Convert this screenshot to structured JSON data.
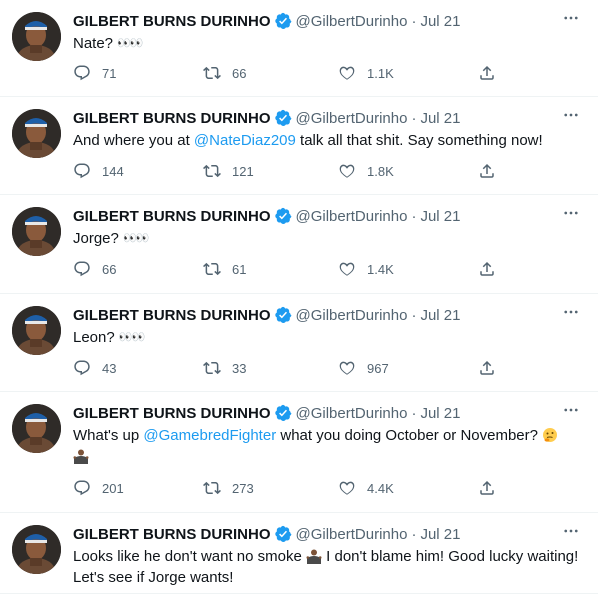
{
  "tweets": [
    {
      "name": "GILBERT BURNS DURINHO",
      "handle": "@GilbertDurinho",
      "dot": "·",
      "time": "Jul 21",
      "segments": [
        {
          "t": "text",
          "v": "Nate? "
        },
        {
          "t": "eyes",
          "v": "👀👀"
        }
      ],
      "stats": {
        "replies": "71",
        "retweets": "66",
        "likes": "1.1K"
      }
    },
    {
      "name": "GILBERT BURNS DURINHO",
      "handle": "@GilbertDurinho",
      "dot": "·",
      "time": "Jul 21",
      "segments": [
        {
          "t": "text",
          "v": "And where you at "
        },
        {
          "t": "mention",
          "v": "@NateDiaz209"
        },
        {
          "t": "text",
          "v": " talk all that shit. Say something now!"
        }
      ],
      "stats": {
        "replies": "144",
        "retweets": "121",
        "likes": "1.8K"
      }
    },
    {
      "name": "GILBERT BURNS DURINHO",
      "handle": "@GilbertDurinho",
      "dot": "·",
      "time": "Jul 21",
      "segments": [
        {
          "t": "text",
          "v": "Jorge? "
        },
        {
          "t": "eyes",
          "v": "👀👀"
        }
      ],
      "stats": {
        "replies": "66",
        "retweets": "61",
        "likes": "1.4K"
      }
    },
    {
      "name": "GILBERT BURNS DURINHO",
      "handle": "@GilbertDurinho",
      "dot": "·",
      "time": "Jul 21",
      "segments": [
        {
          "t": "text",
          "v": "Leon? "
        },
        {
          "t": "eyes",
          "v": "👀👀"
        }
      ],
      "stats": {
        "replies": "43",
        "retweets": "33",
        "likes": "967"
      }
    },
    {
      "name": "GILBERT BURNS DURINHO",
      "handle": "@GilbertDurinho",
      "dot": "·",
      "time": "Jul 21",
      "segments": [
        {
          "t": "text",
          "v": "What's up "
        },
        {
          "t": "mention",
          "v": "@GamebredFighter"
        },
        {
          "t": "text",
          "v": " what you doing October or November? "
        },
        {
          "t": "emoji",
          "v": "thinking-face-emoji"
        },
        {
          "t": "br",
          "v": ""
        },
        {
          "t": "emoji",
          "v": "person-shrugging-emoji"
        }
      ],
      "stats": {
        "replies": "201",
        "retweets": "273",
        "likes": "4.4K"
      }
    },
    {
      "name": "GILBERT BURNS DURINHO",
      "handle": "@GilbertDurinho",
      "dot": "·",
      "time": "Jul 21",
      "segments": [
        {
          "t": "text",
          "v": "Looks like he don't want no smoke "
        },
        {
          "t": "emoji",
          "v": "person-shrugging-emoji"
        },
        {
          "t": "text",
          "v": " I don't blame him! Good lucky waiting! Let's see if Jorge wants!"
        }
      ],
      "stats": null
    }
  ],
  "colors": {
    "link": "#1d9bf0",
    "verified": "#1d9bf0",
    "muted": "#536471"
  },
  "icons": {
    "reply": "reply-icon",
    "retweet": "retweet-icon",
    "like": "like-icon",
    "share": "share-icon",
    "more": "more-icon",
    "verified": "verified-badge-icon"
  }
}
